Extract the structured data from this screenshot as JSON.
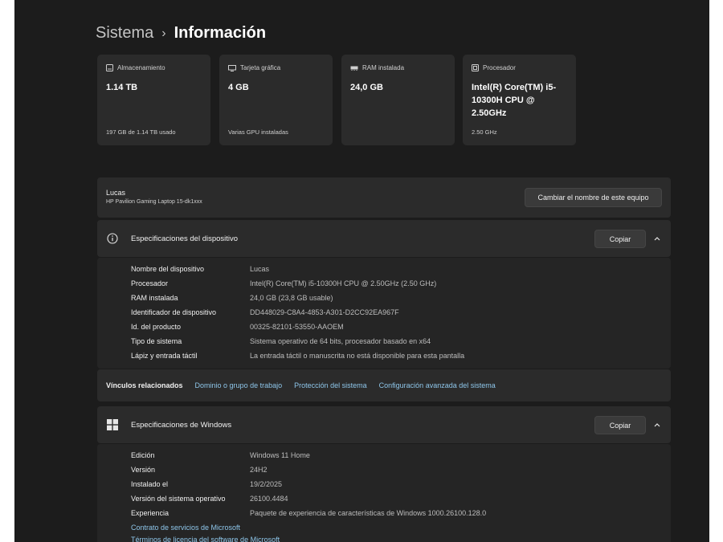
{
  "breadcrumb": {
    "parent": "Sistema",
    "separator": "›",
    "current": "Información"
  },
  "cards": [
    {
      "icon": "storage-icon",
      "label": "Almacenamiento",
      "value": "1.14 TB",
      "sub": "197 GB de 1.14 TB usado"
    },
    {
      "icon": "gpu-icon",
      "label": "Tarjeta gráfica",
      "value": "4 GB",
      "sub": "Varias GPU instaladas"
    },
    {
      "icon": "ram-icon",
      "label": "RAM instalada",
      "value": "24,0 GB",
      "sub": ""
    },
    {
      "icon": "cpu-icon",
      "label": "Procesador",
      "value": "Intel(R) Core(TM) i5-10300H CPU @ 2.50GHz",
      "sub": "2.50 GHz"
    }
  ],
  "device": {
    "name": "Lucas",
    "model": "HP Pavilion Gaming Laptop 15-dk1xxx",
    "rename_label": "Cambiar el nombre de este equipo"
  },
  "device_specs": {
    "title": "Especificaciones del dispositivo",
    "copy_label": "Copiar",
    "rows": [
      {
        "key": "Nombre del dispositivo",
        "value": "Lucas"
      },
      {
        "key": "Procesador",
        "value": "Intel(R) Core(TM) i5-10300H CPU @ 2.50GHz (2.50 GHz)"
      },
      {
        "key": "RAM instalada",
        "value": "24,0 GB (23,8 GB usable)"
      },
      {
        "key": "Identificador de dispositivo",
        "value": "DD448029-C8A4-4853-A301-D2CC92EA967F"
      },
      {
        "key": "Id. del producto",
        "value": "00325-82101-53550-AAOEM"
      },
      {
        "key": "Tipo de sistema",
        "value": "Sistema operativo de 64 bits, procesador basado en x64"
      },
      {
        "key": "Lápiz y entrada táctil",
        "value": "La entrada táctil o manuscrita no está disponible para esta pantalla"
      }
    ]
  },
  "related": {
    "label": "Vínculos relacionados",
    "links": [
      "Dominio o grupo de trabajo",
      "Protección del sistema",
      "Configuración avanzada del sistema"
    ]
  },
  "windows_specs": {
    "title": "Especificaciones de Windows",
    "copy_label": "Copiar",
    "rows": [
      {
        "key": "Edición",
        "value": "Windows 11 Home"
      },
      {
        "key": "Versión",
        "value": "24H2"
      },
      {
        "key": "Instalado el",
        "value": "19/2/2025"
      },
      {
        "key": "Versión del sistema operativo",
        "value": "26100.4484"
      },
      {
        "key": "Experiencia",
        "value": "Paquete de experiencia de características de Windows 1000.26100.128.0"
      }
    ],
    "links": [
      "Contrato de servicios de Microsoft",
      "Términos de licencia del software de Microsoft"
    ]
  }
}
